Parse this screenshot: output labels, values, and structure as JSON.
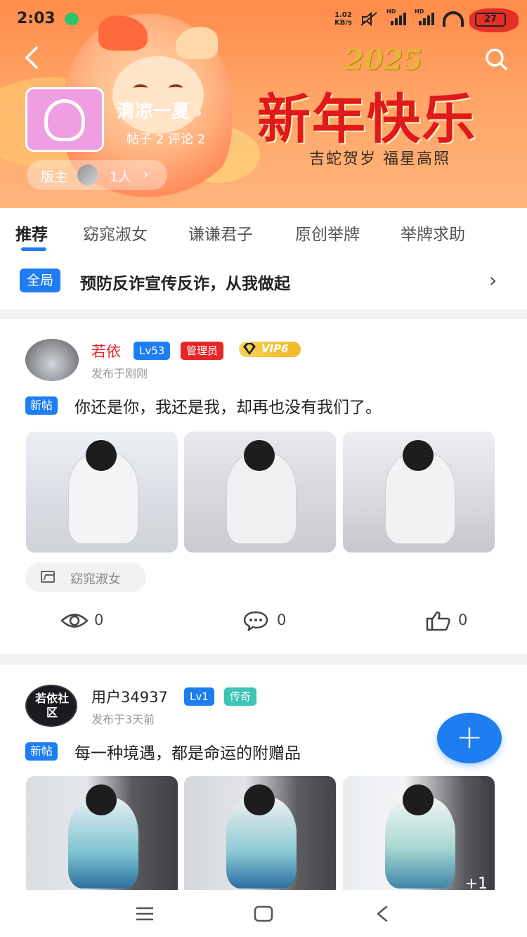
{
  "status_bar": {
    "time": "2:03",
    "network_speed": "1.02",
    "network_unit": "KB/s",
    "signal1_label": "HD",
    "signal2_label": "HD",
    "battery": "27"
  },
  "banner": {
    "year": "2025",
    "title": "新年快乐",
    "subtitle": "吉蛇贺岁 福星高照"
  },
  "forum": {
    "name": "清凉一夏",
    "name_chevron": "›",
    "stats": "帖子 2 评论 2",
    "moderator_label": "版主",
    "moderator_count": "1人",
    "moderator_chevron": "›"
  },
  "tabs": [
    {
      "label": "推荐",
      "active": true
    },
    {
      "label": "窈窕淑女",
      "active": false
    },
    {
      "label": "谦谦君子",
      "active": false
    },
    {
      "label": "原创举牌",
      "active": false
    },
    {
      "label": "举牌求助",
      "active": false
    }
  ],
  "notice": {
    "tag": "全局",
    "text": "预防反诈宣传反诈，从我做起",
    "chevron": "›"
  },
  "posts": [
    {
      "username": "若依",
      "level": "Lv53",
      "role": "管理员",
      "vip": "VIP6",
      "time": "发布于刚刚",
      "tag": "新帖",
      "title": "你还是你，我还是我，却再也没有我们了。",
      "category": "窈窕淑女",
      "views": "0",
      "comments": "0",
      "likes": "0"
    },
    {
      "username": "用户34937",
      "level": "Lv1",
      "rank": "传奇",
      "avatar_text": "若依社区",
      "time": "发布于3天前",
      "tag": "新帖",
      "title": "每一种境遇，都是命运的附赠品",
      "more_images": "+1"
    }
  ],
  "fab": {
    "label": "+"
  },
  "colors": {
    "accent": "#1e7df0",
    "admin_badge": "#e8262a",
    "rank_badge": "#3cc4b4",
    "vip_gold": "#f1b824",
    "banner_red": "#e0191b"
  },
  "icons": [
    "back-arrow-icon",
    "search-icon",
    "eye-icon",
    "comment-icon",
    "thumbs-up-icon",
    "image-icon",
    "menu-icon",
    "home-icon",
    "back-nav-icon"
  ]
}
